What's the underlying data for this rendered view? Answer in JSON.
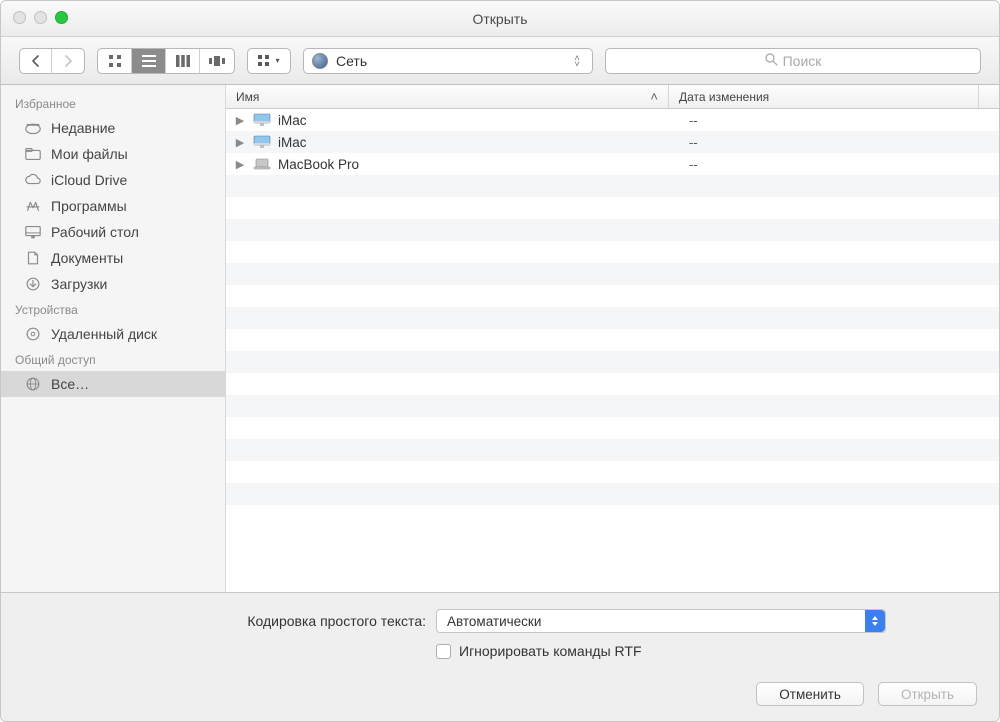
{
  "window": {
    "title": "Открыть"
  },
  "path": {
    "label": "Сеть"
  },
  "search": {
    "placeholder": "Поиск"
  },
  "sidebar": {
    "sections": [
      {
        "label": "Избранное",
        "items": [
          {
            "id": "recents",
            "label": "Недавние",
            "icon": "clock"
          },
          {
            "id": "myfiles",
            "label": "Мои файлы",
            "icon": "folder"
          },
          {
            "id": "icloud",
            "label": "iCloud Drive",
            "icon": "cloud"
          },
          {
            "id": "apps",
            "label": "Программы",
            "icon": "apps"
          },
          {
            "id": "desktop",
            "label": "Рабочий стол",
            "icon": "desktop"
          },
          {
            "id": "documents",
            "label": "Документы",
            "icon": "doc"
          },
          {
            "id": "downloads",
            "label": "Загрузки",
            "icon": "download"
          }
        ]
      },
      {
        "label": "Устройства",
        "items": [
          {
            "id": "remote",
            "label": "Удаленный диск",
            "icon": "disc"
          }
        ]
      },
      {
        "label": "Общий доступ",
        "items": [
          {
            "id": "all",
            "label": "Все…",
            "icon": "globe",
            "selected": true
          }
        ]
      }
    ]
  },
  "columns": {
    "name": "Имя",
    "date": "Дата изменения"
  },
  "rows": [
    {
      "name": "iMac",
      "kind": "imac",
      "date": "--"
    },
    {
      "name": "iMac",
      "kind": "imac",
      "date": "--"
    },
    {
      "name": "MacBook Pro",
      "kind": "macbook",
      "date": "--"
    }
  ],
  "options": {
    "encoding_label": "Кодировка простого текста:",
    "encoding_value": "Автоматически",
    "ignore_rtf_label": "Игнорировать команды RTF"
  },
  "actions": {
    "cancel": "Отменить",
    "open": "Открыть"
  }
}
